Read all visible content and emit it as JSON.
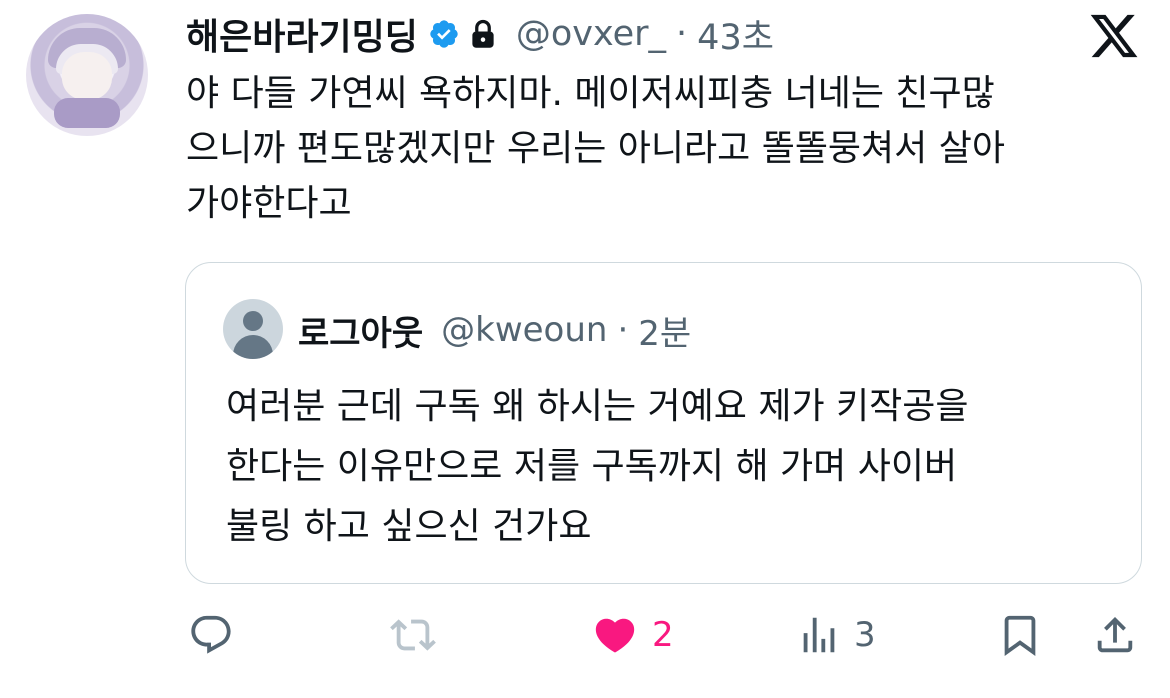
{
  "author": {
    "display_name": "해은바라기밍딩",
    "handle": "@ovxer_",
    "separator": "·",
    "time": "43초",
    "verified": true,
    "protected": true
  },
  "tweet": {
    "text": "야 다들 가연씨 욕하지마. 메이저씨피충 너네는 친구많\n으니까 편도많겠지만 우리는 아니라고 똘똘뭉쳐서 살아\n가야한다고"
  },
  "quoted": {
    "display_name": "로그아웃",
    "handle": "@kweoun",
    "separator": "·",
    "time": "2분",
    "text": "여러분 근데 구독 왜 하시는 거예요 제가 키작공을\n한다는 이유만으로 저를 구독까지 해 가며 사이버\n불링 하고 싶으신 건가요"
  },
  "actions": {
    "replies": "",
    "retweets": "",
    "likes": "2",
    "views": "3"
  },
  "colors": {
    "verified_blue": "#1d9bf0",
    "like_pink": "#f91880",
    "muted_gray": "#536471",
    "border": "#cfd9de"
  },
  "icons": {
    "reply": "reply-icon",
    "retweet": "retweet-icon",
    "like": "heart-icon",
    "views": "views-icon",
    "bookmark": "bookmark-icon",
    "share": "share-icon",
    "logo": "x-logo-icon"
  }
}
